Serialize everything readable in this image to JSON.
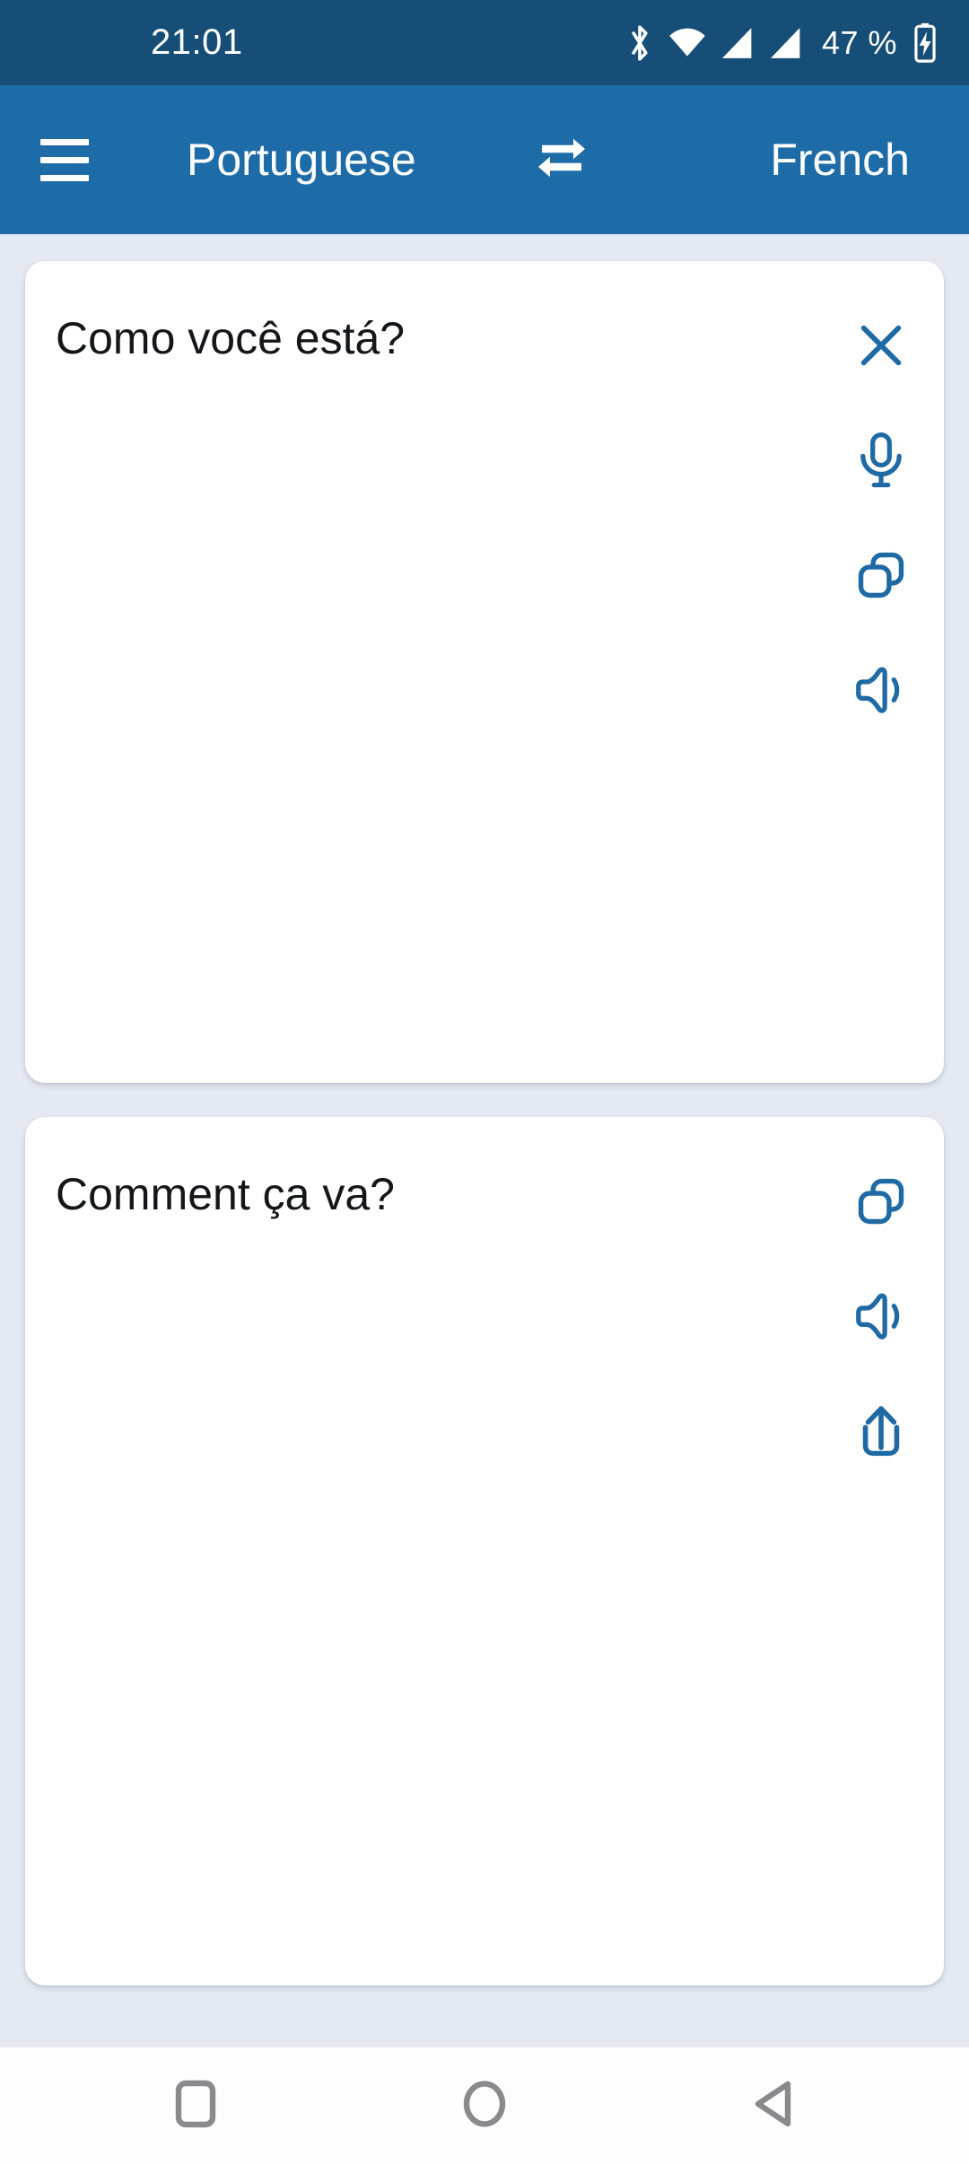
{
  "status_bar": {
    "time": "21:01",
    "battery_percent": "47 %",
    "icons": [
      "bluetooth-icon",
      "wifi-icon",
      "signal-sim1-icon",
      "signal-sim2-icon",
      "battery-charging-icon"
    ],
    "background_color": "#164e78",
    "foreground_color": "#ffffff"
  },
  "app_bar": {
    "menu_icon": "hamburger-menu-icon",
    "source_language": "Portuguese",
    "swap_icon": "swap-horizontal-icon",
    "target_language": "French",
    "background_color": "#1d6ca8",
    "text_color": "#ffffff"
  },
  "theme": {
    "page_background": "#e4e9f2",
    "card_background": "#ffffff",
    "icon_accent": "#1f6aa5",
    "body_text": "#15161a",
    "nav_icon": "#8a8a8e"
  },
  "cards": [
    {
      "name": "source-card",
      "text": "Como você está?",
      "language": "Portuguese",
      "actions": [
        {
          "name": "clear-button",
          "icon": "close-icon"
        },
        {
          "name": "speech-input-button",
          "icon": "microphone-icon"
        },
        {
          "name": "copy-button",
          "icon": "copy-icon"
        },
        {
          "name": "speak-button",
          "icon": "speaker-icon"
        }
      ]
    },
    {
      "name": "target-card",
      "text": "Comment ça va?",
      "language": "French",
      "actions": [
        {
          "name": "copy-button",
          "icon": "copy-icon"
        },
        {
          "name": "speak-button",
          "icon": "speaker-icon"
        },
        {
          "name": "share-button",
          "icon": "share-icon"
        }
      ]
    }
  ],
  "nav_bar": {
    "buttons": [
      {
        "name": "recents-button",
        "icon": "square-icon"
      },
      {
        "name": "home-button",
        "icon": "circle-icon"
      },
      {
        "name": "back-button",
        "icon": "triangle-left-icon"
      }
    ],
    "background_color": "#fdfdfe"
  }
}
